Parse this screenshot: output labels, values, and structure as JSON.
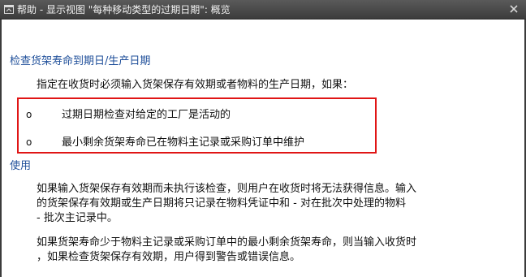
{
  "window": {
    "title": "帮助 - 显示视图 \"每种移动类型的过期日期\": 概览",
    "close_label": "✕"
  },
  "sections": {
    "check_heading": "检查货架寿命到期日/生产日期",
    "check_intro": "指定在收货时必须输入货架保存有效期或者物料的生产日期，如果：",
    "conditions": [
      "过期日期检查对给定的工厂是活动的",
      "最小剩余货架寿命已在物料主记录或采购订单中维护"
    ],
    "bullet_symbol": "o",
    "use_heading": "使用",
    "use_para1_lines": [
      "如果输入货架保存有效期而未执行该检查，则用户在收货时将无法获得信息。输入",
      "的货架保存有效期或生产日期将只记录在物料凭证中和 - 对在批次中处理的物料",
      "- 批次主记录中。"
    ],
    "use_para2_lines": [
      "如果货架寿命少于物料主记录或采购订单中的最小剩余货架寿命，则当输入收货时",
      "，如果检查货架保存有效期，用户得到警告或错误信息。"
    ]
  },
  "colors": {
    "heading": "#1f4f9a",
    "highlight": "#e01515",
    "titlebar": "#3c3c3c"
  }
}
